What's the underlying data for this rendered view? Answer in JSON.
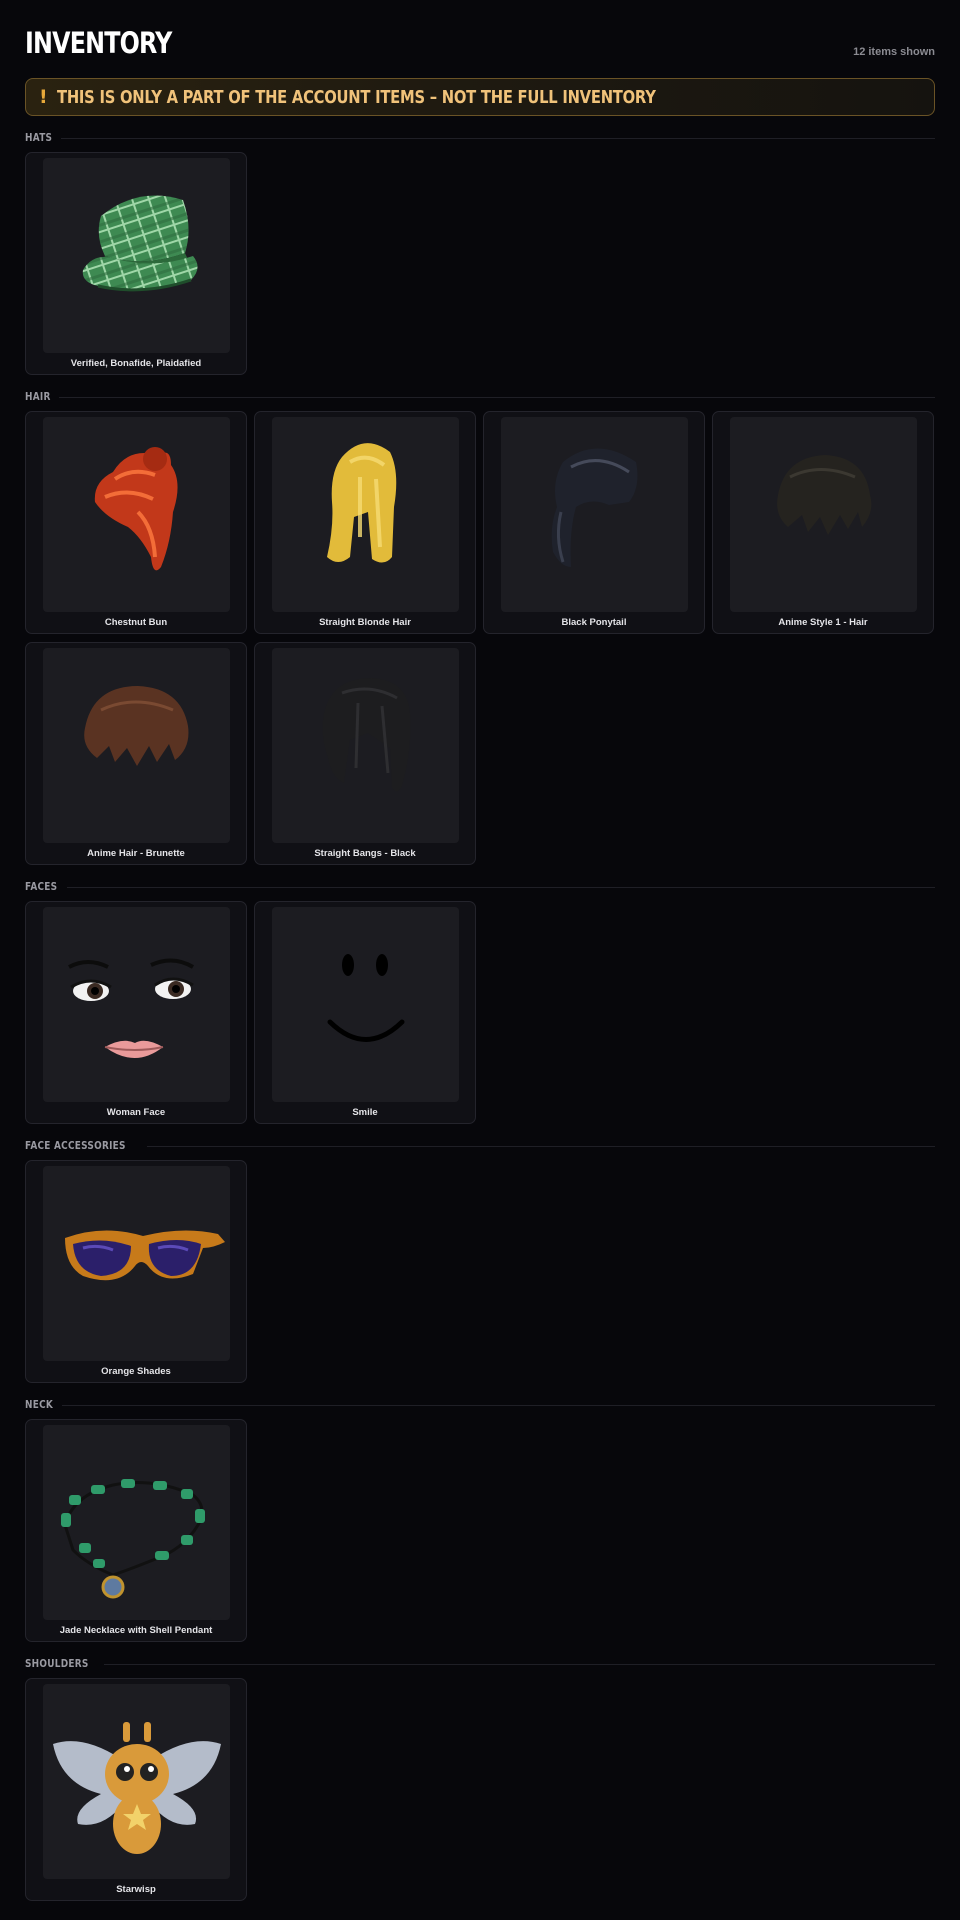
{
  "header": {
    "title": "INVENTORY",
    "count_text": "12 items shown"
  },
  "banner": {
    "icon": "!",
    "text": "THIS IS ONLY A PART OF THE ACCOUNT ITEMS – NOT THE FULL INVENTORY",
    "accent": "#e6a83a"
  },
  "sections": {
    "hats": {
      "label": "HATS",
      "items": [
        {
          "name": "Verified, Bonafide, Plaidafied",
          "icon": "plaid-cap-icon"
        }
      ]
    },
    "hair": {
      "label": "HAIR",
      "items": [
        {
          "name": "Chestnut Bun",
          "icon": "chestnut-bun-icon"
        },
        {
          "name": "Straight Blonde Hair",
          "icon": "blonde-hair-icon"
        },
        {
          "name": "Black Ponytail",
          "icon": "black-ponytail-icon"
        },
        {
          "name": "Anime Style 1 - Hair",
          "icon": "anime-hair-icon"
        },
        {
          "name": "Anime Hair - Brunette",
          "icon": "brunette-hair-icon"
        },
        {
          "name": "Straight Bangs - Black",
          "icon": "black-bangs-icon"
        }
      ]
    },
    "faces": {
      "label": "FACES",
      "items": [
        {
          "name": "Woman Face",
          "icon": "woman-face-icon"
        },
        {
          "name": "Smile",
          "icon": "smile-face-icon"
        }
      ]
    },
    "face_accessories": {
      "label": "FACE ACCESSORIES",
      "items": [
        {
          "name": "Orange Shades",
          "icon": "orange-shades-icon"
        }
      ]
    },
    "neck": {
      "label": "NECK",
      "items": [
        {
          "name": "Jade Necklace with Shell Pendant",
          "icon": "jade-necklace-icon"
        }
      ]
    },
    "shoulders": {
      "label": "SHOULDERS",
      "items": [
        {
          "name": "Starwisp",
          "icon": "starwisp-icon"
        }
      ]
    }
  }
}
